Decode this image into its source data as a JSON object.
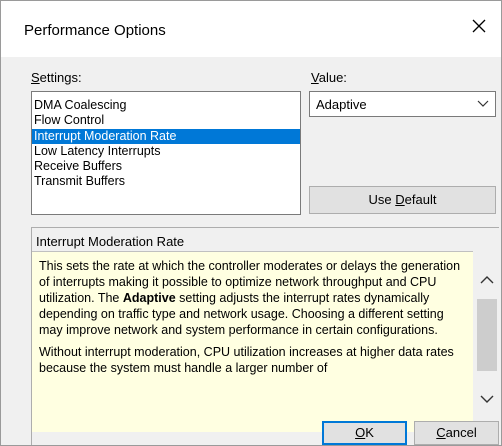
{
  "window": {
    "title": "Performance Options"
  },
  "settings": {
    "label_prefix": "",
    "label_accel": "S",
    "label_rest": "ettings:",
    "items": [
      "DMA Coalescing",
      "Flow Control",
      "Interrupt Moderation Rate",
      "Low Latency Interrupts",
      "Receive Buffers",
      "Transmit Buffers"
    ],
    "selected_index": 2
  },
  "value": {
    "label_accel": "V",
    "label_rest": "alue:",
    "selected": "Adaptive"
  },
  "use_default": {
    "prefix": "Use ",
    "accel": "D",
    "rest": "efault"
  },
  "description": {
    "header": "Interrupt Moderation Rate",
    "p1_a": "This sets the rate at which the controller moderates or delays the generation of interrupts making it possible to optimize network throughput and CPU utilization. The ",
    "p1_bold": "Adaptive",
    "p1_b": " setting adjusts the interrupt rates dynamically depending on traffic type and network usage. Choosing a different setting may improve network and system performance in certain configurations.",
    "p2": "Without interrupt moderation, CPU utilization increases at higher data rates because the system must handle a larger number of"
  },
  "ok": {
    "accel": "O",
    "rest": "K"
  },
  "cancel": {
    "accel": "C",
    "rest": "ancel"
  },
  "colors": {
    "selection": "#0078d7",
    "tooltip_bg": "#ffffe1"
  },
  "icons": {
    "close": "close-icon",
    "dropdown": "chevron-down-icon",
    "scroll_up": "chevron-up-icon",
    "scroll_down": "chevron-down-icon"
  }
}
